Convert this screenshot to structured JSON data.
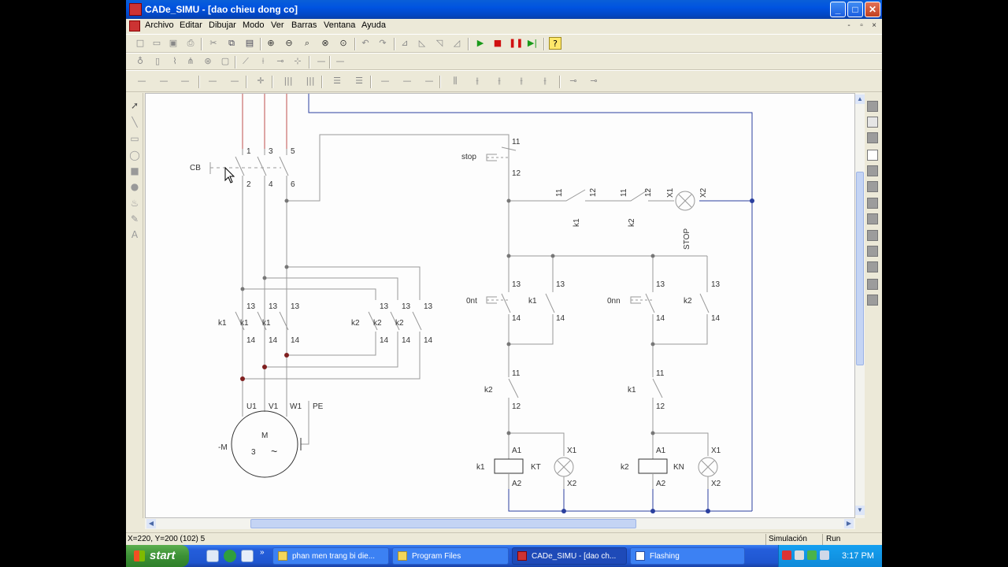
{
  "window": {
    "title": "CADe_SIMU - [dao chieu dong co]",
    "controls": {
      "minimize": "_",
      "maximize": "□",
      "close": "✕"
    }
  },
  "menu": {
    "items": [
      "Archivo",
      "Editar",
      "Dibujar",
      "Modo",
      "Ver",
      "Barras",
      "Ventana",
      "Ayuda"
    ],
    "mdi_controls": [
      "-",
      "▫",
      "×"
    ]
  },
  "diagram": {
    "labels": {
      "cb": "CB",
      "terminals_top": [
        "1",
        "3",
        "5"
      ],
      "terminals_bottom": [
        "2",
        "4",
        "6"
      ],
      "k1_group": [
        "k1",
        "k1",
        "k1"
      ],
      "k2_group": [
        "k2",
        "k2",
        "k2"
      ],
      "contact_13": "13",
      "contact_14": "14",
      "contact_11": "11",
      "contact_12": "12",
      "motor_terms": [
        "U1",
        "V1",
        "W1",
        "PE"
      ],
      "motor_m": "M",
      "motor_3": "3",
      "motor_tilde": "~",
      "motor_name": "-M",
      "stop_btn": "stop",
      "k1": "k1",
      "k2": "k2",
      "x1": "X1",
      "x2": "X2",
      "stop_lamp": "STOP",
      "ont": "0nt",
      "onn": "0nn",
      "a1": "A1",
      "a2": "A2",
      "kt": "KT",
      "kn": "KN"
    },
    "colors": {
      "power_line": "#c0504d",
      "neutral_line": "#2a3f9e",
      "wire": "#999999",
      "junction": "#7f1f1f"
    }
  },
  "status": {
    "coords": "X=220, Y=200 (102) 5",
    "mode": "Simulación",
    "state": "Run"
  },
  "taskbar": {
    "start": "start",
    "tasks": [
      {
        "label": "phan men trang bi die..."
      },
      {
        "label": "Program Files"
      },
      {
        "label": "CADe_SIMU - [dao ch..."
      },
      {
        "label": "Flashing"
      }
    ],
    "clock": "3:17 PM"
  }
}
